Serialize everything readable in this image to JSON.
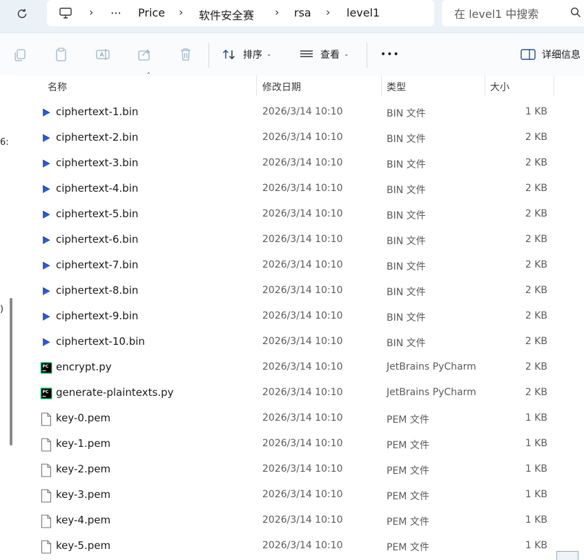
{
  "breadcrumb": {
    "overflow": "⋯",
    "items": [
      "Price",
      "软件安全赛",
      "rsa",
      "level1"
    ]
  },
  "search": {
    "placeholder": "在 level1 中搜索"
  },
  "toolbar": {
    "sort_label": "排序",
    "view_label": "查看",
    "more_label": "•••",
    "details_label": "详细信息"
  },
  "columns": {
    "name": "名称",
    "date": "修改日期",
    "type": "类型",
    "size": "大小"
  },
  "left_strip": {
    "chars": [
      "6:",
      ")"
    ]
  },
  "files": [
    {
      "name": "ciphertext-1.bin",
      "date": "2026/3/14 10:10",
      "type": "BIN 文件",
      "size": "1 KB",
      "icon": "bin-file-icon"
    },
    {
      "name": "ciphertext-2.bin",
      "date": "2026/3/14 10:10",
      "type": "BIN 文件",
      "size": "2 KB",
      "icon": "bin-file-icon"
    },
    {
      "name": "ciphertext-3.bin",
      "date": "2026/3/14 10:10",
      "type": "BIN 文件",
      "size": "2 KB",
      "icon": "bin-file-icon"
    },
    {
      "name": "ciphertext-4.bin",
      "date": "2026/3/14 10:10",
      "type": "BIN 文件",
      "size": "2 KB",
      "icon": "bin-file-icon"
    },
    {
      "name": "ciphertext-5.bin",
      "date": "2026/3/14 10:10",
      "type": "BIN 文件",
      "size": "2 KB",
      "icon": "bin-file-icon"
    },
    {
      "name": "ciphertext-6.bin",
      "date": "2026/3/14 10:10",
      "type": "BIN 文件",
      "size": "2 KB",
      "icon": "bin-file-icon"
    },
    {
      "name": "ciphertext-7.bin",
      "date": "2026/3/14 10:10",
      "type": "BIN 文件",
      "size": "2 KB",
      "icon": "bin-file-icon"
    },
    {
      "name": "ciphertext-8.bin",
      "date": "2026/3/14 10:10",
      "type": "BIN 文件",
      "size": "2 KB",
      "icon": "bin-file-icon"
    },
    {
      "name": "ciphertext-9.bin",
      "date": "2026/3/14 10:10",
      "type": "BIN 文件",
      "size": "2 KB",
      "icon": "bin-file-icon"
    },
    {
      "name": "ciphertext-10.bin",
      "date": "2026/3/14 10:10",
      "type": "BIN 文件",
      "size": "2 KB",
      "icon": "bin-file-icon"
    },
    {
      "name": "encrypt.py",
      "date": "2026/3/14 10:10",
      "type": "JetBrains PyCharm",
      "size": "2 KB",
      "icon": "pycharm-file-icon"
    },
    {
      "name": "generate-plaintexts.py",
      "date": "2026/3/14 10:10",
      "type": "JetBrains PyCharm",
      "size": "2 KB",
      "icon": "pycharm-file-icon"
    },
    {
      "name": "key-0.pem",
      "date": "2026/3/14 10:10",
      "type": "PEM 文件",
      "size": "1 KB",
      "icon": "blank-file-icon"
    },
    {
      "name": "key-1.pem",
      "date": "2026/3/14 10:10",
      "type": "PEM 文件",
      "size": "1 KB",
      "icon": "blank-file-icon"
    },
    {
      "name": "key-2.pem",
      "date": "2026/3/14 10:10",
      "type": "PEM 文件",
      "size": "1 KB",
      "icon": "blank-file-icon"
    },
    {
      "name": "key-3.pem",
      "date": "2026/3/14 10:10",
      "type": "PEM 文件",
      "size": "1 KB",
      "icon": "blank-file-icon"
    },
    {
      "name": "key-4.pem",
      "date": "2026/3/14 10:10",
      "type": "PEM 文件",
      "size": "1 KB",
      "icon": "blank-file-icon"
    },
    {
      "name": "key-5.pem",
      "date": "2026/3/14 10:10",
      "type": "PEM 文件",
      "size": "1 KB",
      "icon": "blank-file-icon"
    }
  ]
}
